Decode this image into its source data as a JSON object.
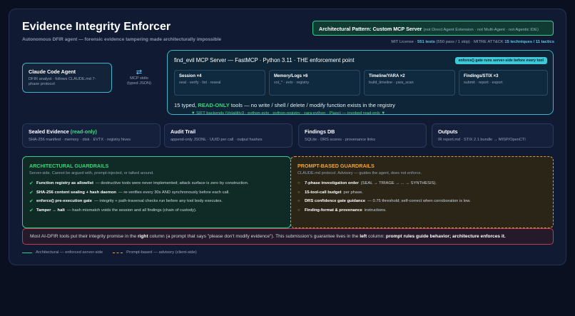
{
  "title": "Evidence Integrity Enforcer",
  "subtitle": "Autonomous DFIR agent — forensic evidence tampering made architecturally impossible",
  "pattern": {
    "label": "Architectural Pattern: Custom MCP Server",
    "note": "(not Direct Agent Extension · not Multi-Agent · not Agentic IDE)"
  },
  "meta": {
    "license": "MIT License",
    "sep1": " · ",
    "tests": "551 tests",
    "tests_detail": " (550 pass / 1 skip) · ",
    "mitre_prefix": "MITRE ATT&CK ",
    "mitre": "15 techniques / 11 tactics"
  },
  "agent": {
    "title": "Claude Code Agent",
    "desc": "DFIR analyst · follows CLAUDE.md 7-phase protocol"
  },
  "stdio": {
    "arrow": "⇄",
    "line1": "MCP stdio",
    "line2": "(typed JSON)"
  },
  "mcp": {
    "title": "find_evil MCP Server — FastMCP · Python 3.11 · THE enforcement point",
    "badge": "enforce() gate runs server-side before every tool",
    "tools": [
      {
        "name": "Session ×4",
        "desc": "seal · verify · list · reseal"
      },
      {
        "name": "Memory/Logs ×6",
        "desc": "vol_* · evtx · registry"
      },
      {
        "name": "Timeline/YARA ×2",
        "desc": "build_timeline · yara_scan"
      },
      {
        "name": "Findings/STIX ×3",
        "desc": "submit · report · export"
      }
    ],
    "readonly_pre": "15 typed, ",
    "readonly_hl": "READ-ONLY",
    "readonly_post": " tools — no write / shell / delete / modify function exists in the registry"
  },
  "sift": "▼ SIFT backends (Volatility3 · python-evtx · python-registry · yara-python · Plaso) — invoked read-only ▼",
  "stores": [
    {
      "title": "Sealed Evidence ",
      "highlight": "(read-only)",
      "desc": "SHA-256 manifest · memory · disk · EVTX · registry hives"
    },
    {
      "title": "Audit Trail",
      "highlight": "",
      "desc": "append-only JSONL · UUID per call · output hashes"
    },
    {
      "title": "Findings DB",
      "highlight": "",
      "desc": "SQLite · DRS scores · provenance links"
    },
    {
      "title": "Outputs",
      "highlight": "",
      "desc": "IR report.md · STIX 2.1 bundle → MISP/OpenCTI"
    }
  ],
  "arch": {
    "title": "ARCHITECTURAL GUARDRAILS",
    "subtitle": "Server-side. Cannot be argued with, prompt-injected, or talked around.",
    "mark": "✔",
    "items": [
      {
        "bold": "Function registry as allowlist",
        "text": "— destructive tools were never implemented; attack surface is zero by construction."
      },
      {
        "bold": "SHA-256 content sealing + hash daemon",
        "text": "— re-verifies every 30s AND synchronously before each call."
      },
      {
        "bold": "enforce() pre-execution gate",
        "text": "— integrity + path-traversal checks run before any tool body executes."
      },
      {
        "bold": "Tamper → halt",
        "text": "— hash mismatch voids the session and all findings (chain of custody)."
      }
    ]
  },
  "prompt": {
    "title": "PROMPT-BASED GUARDRAILS",
    "subtitle": "CLAUDE.md protocol. Advisory — guides the agent, does not enforce.",
    "mark": "○",
    "items": [
      {
        "bold": "7-phase investigation order",
        "text": "(SEAL → TRIAGE → ... → SYNTHESIS)."
      },
      {
        "bold": "15-tool-call budget",
        "text": "per phase."
      },
      {
        "bold": "DRS confidence gate guidance",
        "text": "— 0.75 threshold; self-correct when corroboration is low."
      },
      {
        "bold": "Finding-format & provenance",
        "text": "instructions."
      }
    ]
  },
  "note": {
    "t1": "Most AI-DFIR tools put their integrity promise in the ",
    "b1": "right",
    "t2": " column (a prompt that says \"please don't modify evidence\"). This submission's guarantee lives in the ",
    "b2": "left",
    "t3": " column: ",
    "b3": "prompt rules guide behavior; architecture enforces it."
  },
  "legend": {
    "solid": "Architectural — enforced server-side",
    "dashed": "Prompt-based — advisory (client-side)"
  },
  "colors": {
    "accent_green": "#2fcf8e",
    "accent_cyan": "#3fb3c9",
    "accent_amber": "#f0a735",
    "accent_red": "#c23b4d"
  }
}
